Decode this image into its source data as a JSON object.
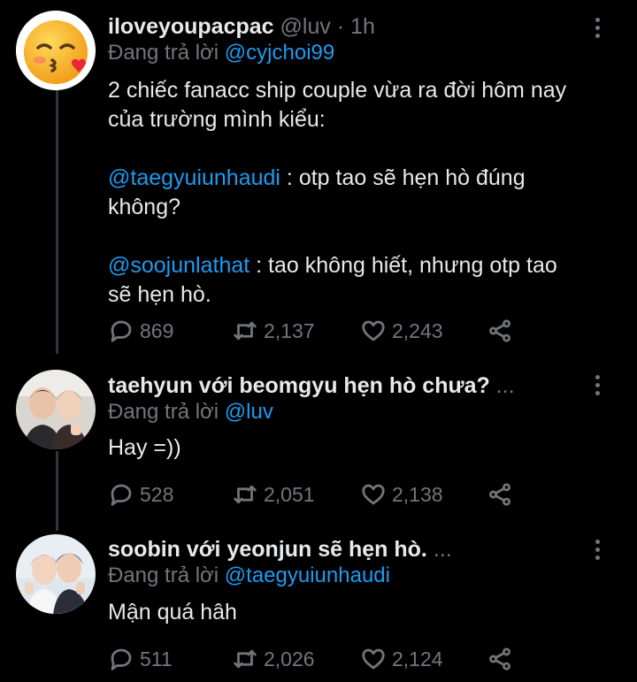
{
  "tweets": [
    {
      "display_name": "iloveyoupacpac",
      "handle": "@luv",
      "time": "· 1h",
      "reply_prefix": "Đang trả lời",
      "reply_to": "@cyjchoi99",
      "lines": {
        "l1": "2 chiếc fanacc ship couple vừa ra đời hôm nay",
        "l2": "của trường mình kiểu:",
        "m1": "@taegyuiunhaudi",
        "l3": " : otp tao sẽ hẹn hò đúng",
        "l4": "không?",
        "m2": "@soojunlathat",
        "l5": " : tao không hiết, nhưng otp tao",
        "l6": "sẽ hẹn hò."
      },
      "replies": "869",
      "retweets": "2,137",
      "likes": "2,243"
    },
    {
      "display_name": "taehyun với beomgyu hẹn hò chưa?",
      "ellipsis": "...",
      "reply_prefix": "Đang trả lời",
      "reply_to": "@luv",
      "text": "Hay =))",
      "replies": "528",
      "retweets": "2,051",
      "likes": "2,138"
    },
    {
      "display_name": "soobin với yeonjun sẽ hẹn hò.",
      "ellipsis": "...",
      "reply_prefix": "Đang trả lời",
      "reply_to": "@taegyuiunhaudi",
      "text": "Mận quá hâh",
      "replies": "511",
      "retweets": "2,026",
      "likes": "2,124"
    }
  ],
  "icons": {
    "reply": "reply-icon",
    "retweet": "retweet-icon",
    "like": "heart-icon",
    "share": "share-icon",
    "more": "more-vertical-icon",
    "avatar1": "kissing-face-emoji"
  },
  "colors": {
    "background": "#000000",
    "text": "#e7e9ea",
    "muted": "#71767b",
    "link": "#1d9bf0"
  }
}
